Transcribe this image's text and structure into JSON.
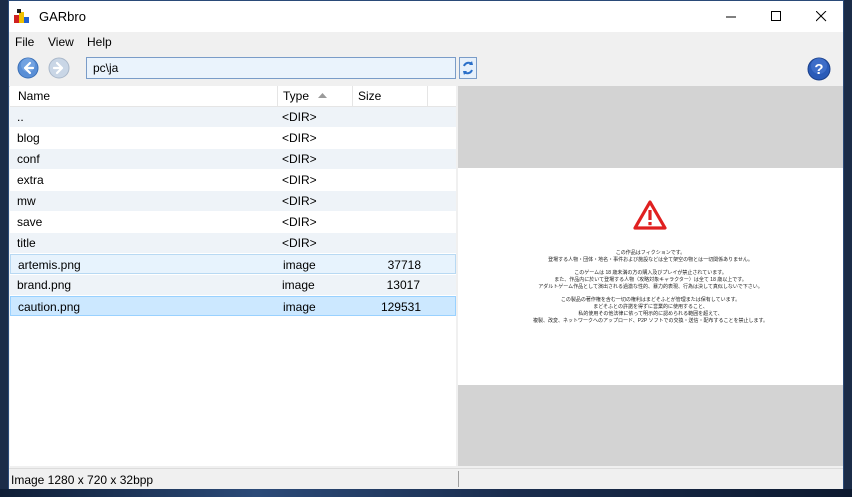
{
  "window": {
    "title": "GARbro"
  },
  "menu": {
    "file": "File",
    "view": "View",
    "help": "Help"
  },
  "toolbar": {
    "path_value": "pc\\ja"
  },
  "filelist": {
    "columns": {
      "name": "Name",
      "type": "Type",
      "size": "Size"
    },
    "rows": [
      {
        "name": "..",
        "type": "<DIR>",
        "size": ""
      },
      {
        "name": "blog",
        "type": "<DIR>",
        "size": ""
      },
      {
        "name": "conf",
        "type": "<DIR>",
        "size": ""
      },
      {
        "name": "extra",
        "type": "<DIR>",
        "size": ""
      },
      {
        "name": "mw",
        "type": "<DIR>",
        "size": ""
      },
      {
        "name": "save",
        "type": "<DIR>",
        "size": ""
      },
      {
        "name": "title",
        "type": "<DIR>",
        "size": ""
      },
      {
        "name": "artemis.png",
        "type": "image",
        "size": "37718"
      },
      {
        "name": "brand.png",
        "type": "image",
        "size": "13017"
      },
      {
        "name": "caution.png",
        "type": "image",
        "size": "129531"
      }
    ],
    "highlighted_row": "artemis.png",
    "selected_row": "caution.png"
  },
  "preview": {
    "lines": [
      "この作品はフィクションです。",
      "登場する人物・団体・地名・事件および施設などは全て架空の物とは一切関係ありません。",
      "このゲームは 18 歳未満の方の購入及びプレイが禁止されています。",
      "また、作品内に於いて登場する人物（攻略対象キャラクター）は全て 18 歳以上です。",
      "アダルトゲーム作品として演出される過激な性的、暴力的表現、行為は決して真似しないで下さい。",
      "この製品の著作権を含む一切の権利はまどそふとが管理または保有しています。",
      "まどそふとの許諾を得ずに営業的に使用すること、",
      "私的使用その他法律に依って明示的に認められる範囲を超えて、",
      "複製、改変、ネットワークへのアップロード、P2P ソフトでの交換・送信・配布することを禁止します。"
    ]
  },
  "status": {
    "text": "Image 1280 x 720 x 32bpp"
  },
  "colors": {
    "accent": "#3c78d8",
    "caution_red": "#e02020",
    "selection": "#cce8ff"
  }
}
